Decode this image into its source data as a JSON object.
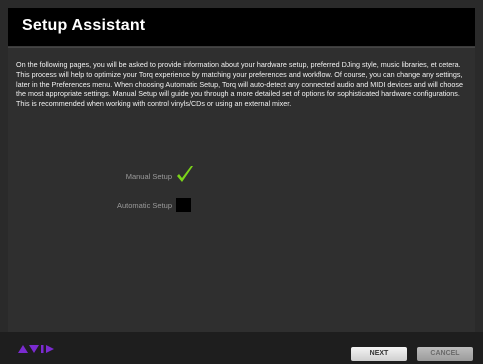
{
  "window": {
    "title": "Setup Assistant",
    "description": "On the following pages, you will be asked to provide information about your hardware setup, preferred DJing style, music libraries, et cetera. This process will help to optimize your Torq experience by matching your preferences and workflow. Of course, you can change any settings, later in the Preferences menu. When choosing Automatic Setup, Torq will auto-detect any connected audio and MIDI devices and will choose the most appropriate settings. Manual Setup will guide you through a more detailed set of options for sophisticated hardware configurations. This is recommended when working with control vinyls/CDs or using an external mixer."
  },
  "options": [
    {
      "label": "Manual Setup",
      "checked": true
    },
    {
      "label": "Automatic Setup",
      "checked": false
    }
  ],
  "footer": {
    "logo": "AVID",
    "next_label": "NEXT",
    "cancel_label": "CANCEL"
  },
  "colors": {
    "check": "#7bd41a",
    "logo": "#7b2bd1"
  }
}
